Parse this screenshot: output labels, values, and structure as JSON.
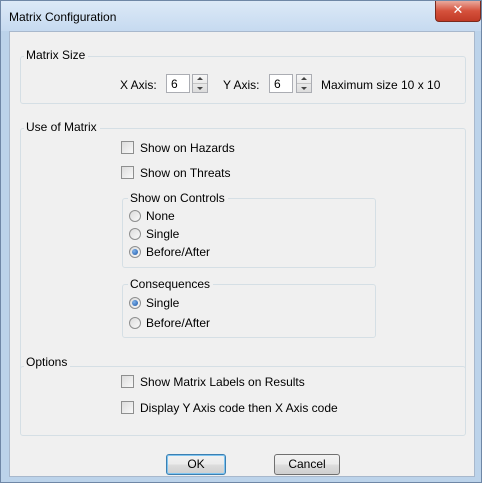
{
  "window": {
    "title": "Matrix Configuration",
    "close_glyph": "✕"
  },
  "matrix_size": {
    "label": "Matrix Size",
    "x_axis_label": "X Axis:",
    "x_axis_value": "6",
    "y_axis_label": "Y Axis:",
    "y_axis_value": "6",
    "max_text": "Maximum size 10 x 10"
  },
  "use_of_matrix": {
    "label": "Use of Matrix",
    "show_on_hazards": {
      "label": "Show on Hazards",
      "checked": false
    },
    "show_on_threats": {
      "label": "Show on Threats",
      "checked": false
    },
    "show_on_controls": {
      "label": "Show on Controls",
      "options": [
        "None",
        "Single",
        "Before/After"
      ],
      "selected": "Before/After"
    },
    "consequences": {
      "label": "Consequences",
      "options": [
        "Single",
        "Before/After"
      ],
      "selected": "Single"
    }
  },
  "options": {
    "label": "Options",
    "show_matrix_labels": {
      "label": "Show Matrix Labels on Results",
      "checked": false
    },
    "display_y_then_x": {
      "label": "Display Y Axis code then X Axis code",
      "checked": false
    }
  },
  "buttons": {
    "ok": "OK",
    "cancel": "Cancel"
  }
}
